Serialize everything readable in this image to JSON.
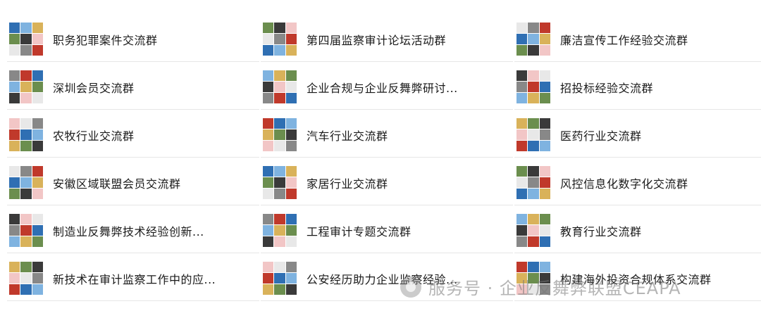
{
  "columns": [
    {
      "items": [
        {
          "label": "职务犯罪案件交流群"
        },
        {
          "label": "深圳会员交流群"
        },
        {
          "label": "农牧行业交流群"
        },
        {
          "label": "安徽区域联盟会员交流群"
        },
        {
          "label": "制造业反舞弊技术经验创新..."
        },
        {
          "label": "新技术在审计监察工作中的应..."
        }
      ]
    },
    {
      "items": [
        {
          "label": "第四届监察审计论坛活动群"
        },
        {
          "label": "企业合规与企业反舞弊研讨..."
        },
        {
          "label": "汽车行业交流群"
        },
        {
          "label": "家居行业交流群"
        },
        {
          "label": "工程审计专题交流群"
        },
        {
          "label": "公安经历助力企业监察经验..."
        }
      ]
    },
    {
      "items": [
        {
          "label": "廉洁宣传工作经验交流群"
        },
        {
          "label": "招投标经验交流群"
        },
        {
          "label": "医药行业交流群"
        },
        {
          "label": "风控信息化数字化交流群"
        },
        {
          "label": "教育行业交流群"
        },
        {
          "label": "构建海外投资合规体系交流群"
        }
      ]
    }
  ],
  "watermark": {
    "text": "服务号 · 企业反舞弊联盟CEAPA"
  },
  "avatar_palette": [
    "#2f6fb3",
    "#d9b25a",
    "#3a3a3a",
    "#e8e8e8",
    "#c0392b",
    "#7fb3e0",
    "#6b8e4e",
    "#f2c6c6",
    "#888888"
  ]
}
